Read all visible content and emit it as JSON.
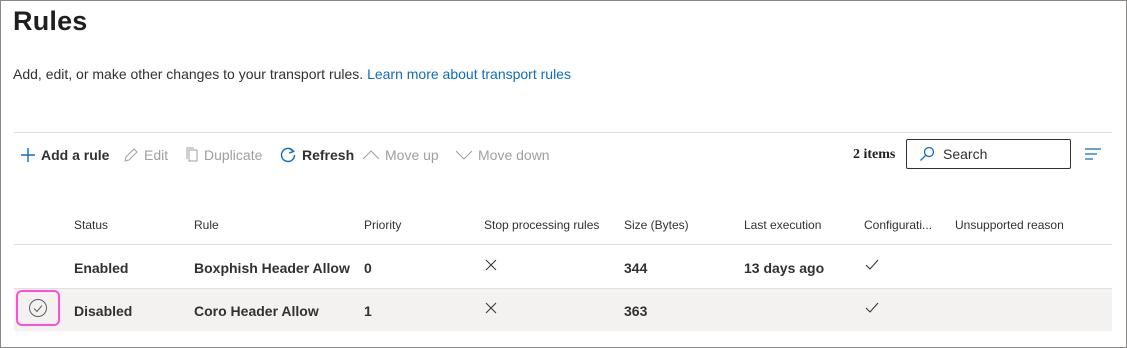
{
  "page": {
    "title": "Rules",
    "description": "Add, edit, or make other changes to your transport rules.",
    "learn_more_link": "Learn more about transport rules"
  },
  "toolbar": {
    "add_rule": "Add a rule",
    "edit": "Edit",
    "duplicate": "Duplicate",
    "refresh": "Refresh",
    "move_up": "Move up",
    "move_down": "Move down",
    "item_count": "2 items",
    "search_placeholder": "Search"
  },
  "table": {
    "columns": [
      "Status",
      "Rule",
      "Priority",
      "Stop processing rules",
      "Size (Bytes)",
      "Last execution",
      "Configurati...",
      "Unsupported reason"
    ],
    "rows": [
      {
        "status": "Enabled",
        "rule": "Boxphish Header Allow",
        "priority": "0",
        "stop_processing": "x-icon",
        "size": "344",
        "last_execution": "13 days ago",
        "configuration": "checkmark-icon",
        "unsupported_reason": "",
        "selected": false
      },
      {
        "status": "Disabled",
        "rule": "Coro Header Allow",
        "priority": "1",
        "stop_processing": "x-icon",
        "size": "363",
        "last_execution": "",
        "configuration": "checkmark-icon",
        "unsupported_reason": "",
        "selected": true
      }
    ]
  },
  "colors": {
    "accent": "#0f6cbd",
    "selection_highlight": "#ff4fd8",
    "selected_row_bg": "#f3f2f1",
    "disabled_text": "#a19f9d"
  }
}
